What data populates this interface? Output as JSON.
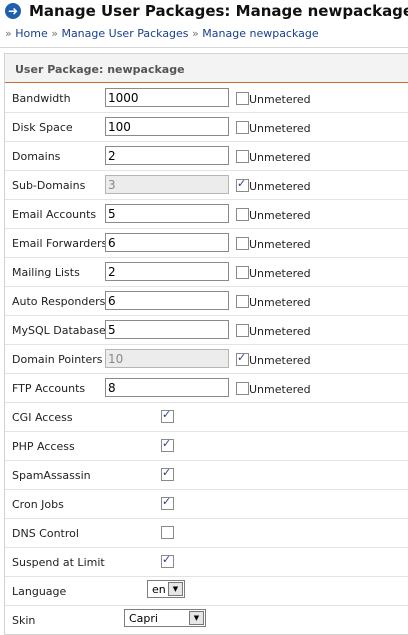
{
  "header": {
    "title": "Manage User Packages: Manage newpackage",
    "icon": "arrow-right-circle-icon"
  },
  "breadcrumb": {
    "sep": "»",
    "items": [
      "Home",
      "Manage User Packages",
      "Manage newpackage"
    ]
  },
  "panel": {
    "title": "User Package: newpackage"
  },
  "unmetered_label": "Unmetered",
  "limits": [
    {
      "label": "Bandwidth",
      "value": "1000",
      "unmetered": false,
      "disabled": false
    },
    {
      "label": "Disk Space",
      "value": "100",
      "unmetered": false,
      "disabled": false
    },
    {
      "label": "Domains",
      "value": "2",
      "unmetered": false,
      "disabled": false
    },
    {
      "label": "Sub-Domains",
      "value": "3",
      "unmetered": true,
      "disabled": true
    },
    {
      "label": "Email Accounts",
      "value": "5",
      "unmetered": false,
      "disabled": false
    },
    {
      "label": "Email Forwarders",
      "value": "6",
      "unmetered": false,
      "disabled": false
    },
    {
      "label": "Mailing Lists",
      "value": "2",
      "unmetered": false,
      "disabled": false
    },
    {
      "label": "Auto Responders",
      "value": "6",
      "unmetered": false,
      "disabled": false
    },
    {
      "label": "MySQL Databases",
      "value": "5",
      "unmetered": false,
      "disabled": false
    },
    {
      "label": "Domain Pointers",
      "value": "10",
      "unmetered": true,
      "disabled": true
    },
    {
      "label": "FTP Accounts",
      "value": "8",
      "unmetered": false,
      "disabled": false
    }
  ],
  "features": [
    {
      "label": "CGI Access",
      "checked": true
    },
    {
      "label": "PHP Access",
      "checked": true
    },
    {
      "label": "SpamAssassin",
      "checked": true
    },
    {
      "label": "Cron Jobs",
      "checked": true
    },
    {
      "label": "DNS Control",
      "checked": false
    },
    {
      "label": "Suspend at Limit",
      "checked": true
    }
  ],
  "language": {
    "label": "Language",
    "value": "en"
  },
  "skin": {
    "label": "Skin",
    "value": "Capri"
  }
}
